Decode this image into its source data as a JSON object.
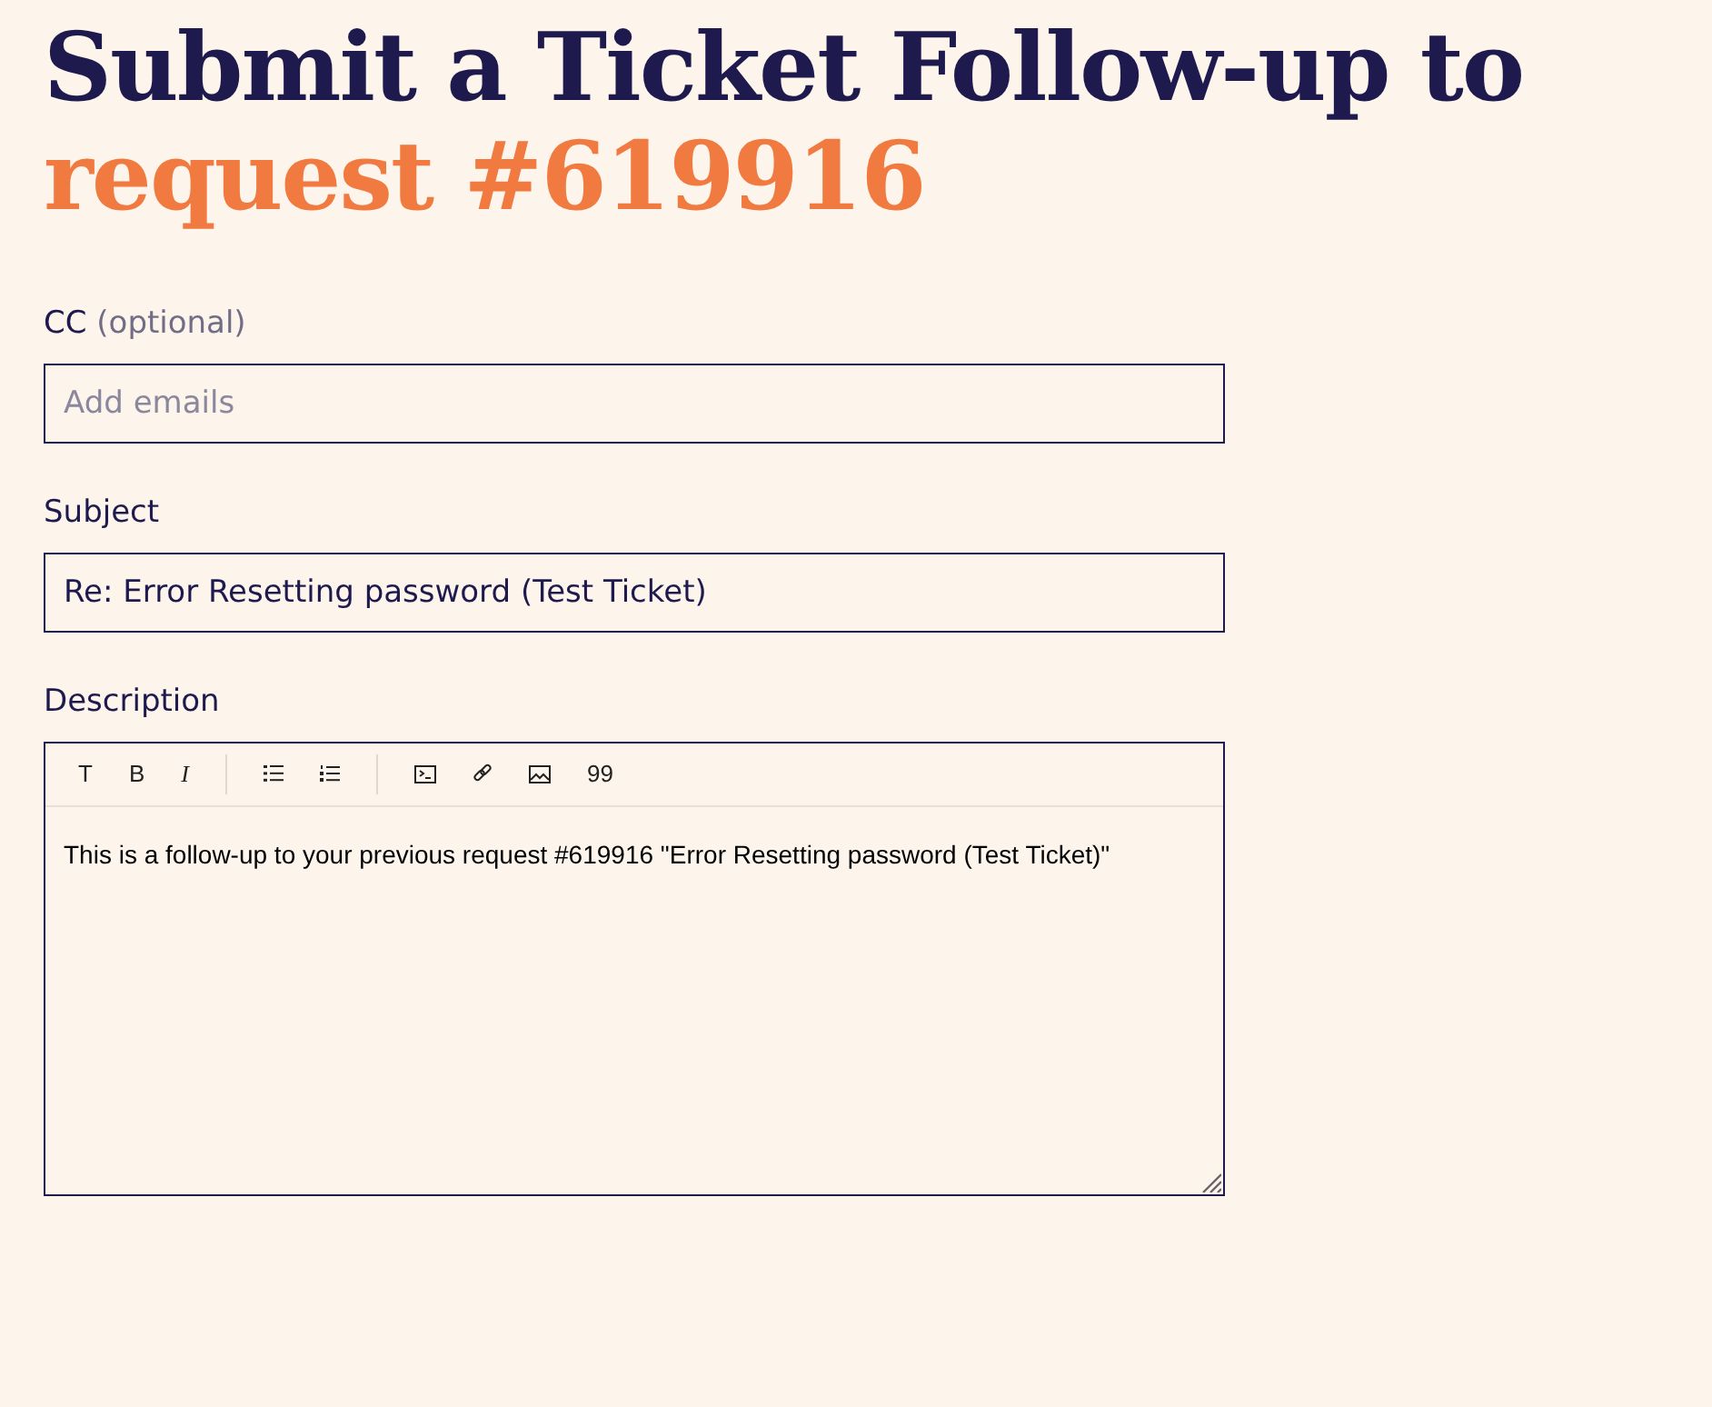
{
  "title": {
    "line_1": "Submit a Ticket Follow-up to",
    "line_2": "request #619916"
  },
  "fields": [
    {
      "label": "CC",
      "hint": "(optional)",
      "placeholder": "Add emails"
    },
    {
      "label": "Subject",
      "value": "Re: Error Resetting password (Test Ticket)"
    }
  ],
  "description": {
    "label": "Description",
    "toolbar": [
      [
        {
          "kind": "text",
          "label": "T"
        },
        {
          "kind": "text",
          "label": "B"
        },
        {
          "kind": "italic",
          "label": "I"
        }
      ],
      [
        {
          "kind": "bullet-list"
        },
        {
          "kind": "numbered-list"
        }
      ],
      [
        {
          "kind": "code"
        },
        {
          "kind": "link"
        },
        {
          "kind": "image"
        },
        {
          "kind": "text",
          "label": "99"
        }
      ]
    ],
    "body": "This is a follow-up to your previous request #619916 \"Error Resetting password (Test Ticket)\""
  }
}
